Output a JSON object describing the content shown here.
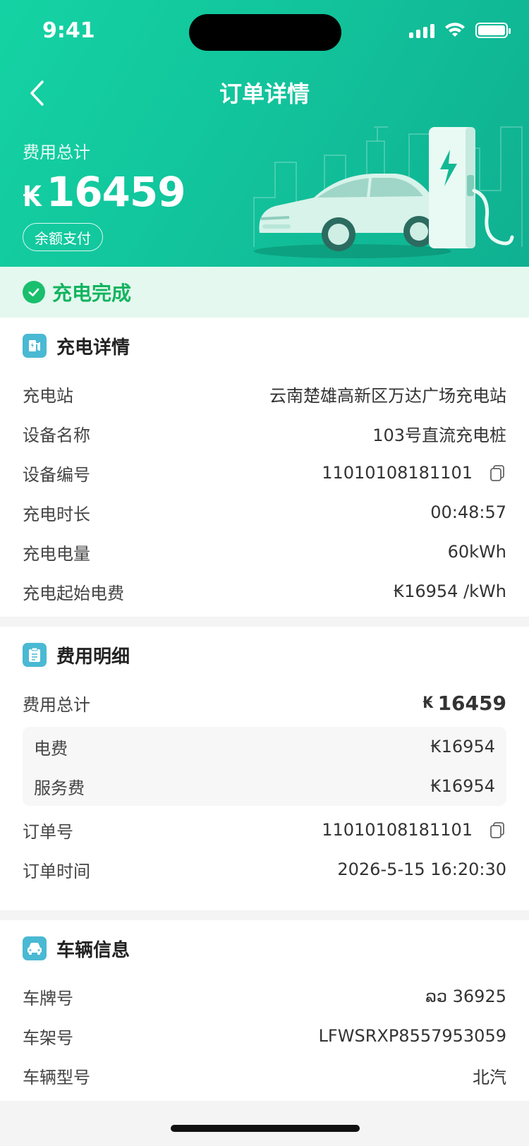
{
  "status_bar": {
    "time": "9:41"
  },
  "nav": {
    "title": "订单详情",
    "back_icon": "chevron-left-icon"
  },
  "summary": {
    "label": "费用总计",
    "currency": "₭",
    "amount": "16459",
    "pay_method": "余额支付"
  },
  "charge_status": {
    "text": "充电完成",
    "color": "#13b45f"
  },
  "charge_details": {
    "title": "充电详情",
    "rows": [
      {
        "label": "充电站",
        "value": "云南楚雄高新区万达广场充电站"
      },
      {
        "label": "设备名称",
        "value": "103号直流充电桩"
      },
      {
        "label": "设备编号",
        "value": "11010108181101"
      },
      {
        "label": "充电时长",
        "value": "00:48:57"
      },
      {
        "label": "充电电量",
        "value": "60kWh"
      },
      {
        "label": "充电起始电费",
        "value": "₭16954 /kWh"
      }
    ]
  },
  "fee_details": {
    "title": "费用明细",
    "total_label": "费用总计",
    "total_currency": "₭",
    "total_value": "16459",
    "items": [
      {
        "label": "电费",
        "value": "₭16954"
      },
      {
        "label": "服务费",
        "value": "₭16954"
      }
    ],
    "order_no_label": "订单号",
    "order_no": "11010108181101",
    "order_time_label": "订单时间",
    "order_time": "2026-5-15 16:20:30"
  },
  "vehicle_info": {
    "title": "车辆信息",
    "rows": [
      {
        "label": "车牌号",
        "value": "ລວ 36925"
      },
      {
        "label": "车架号",
        "value": "LFWSRXP8557953059"
      },
      {
        "label": "车辆型号",
        "value": "北汽"
      }
    ]
  },
  "colors": {
    "brand": "#12c49c",
    "success": "#19bf6d",
    "icon_bg": "#4ab9d3"
  }
}
